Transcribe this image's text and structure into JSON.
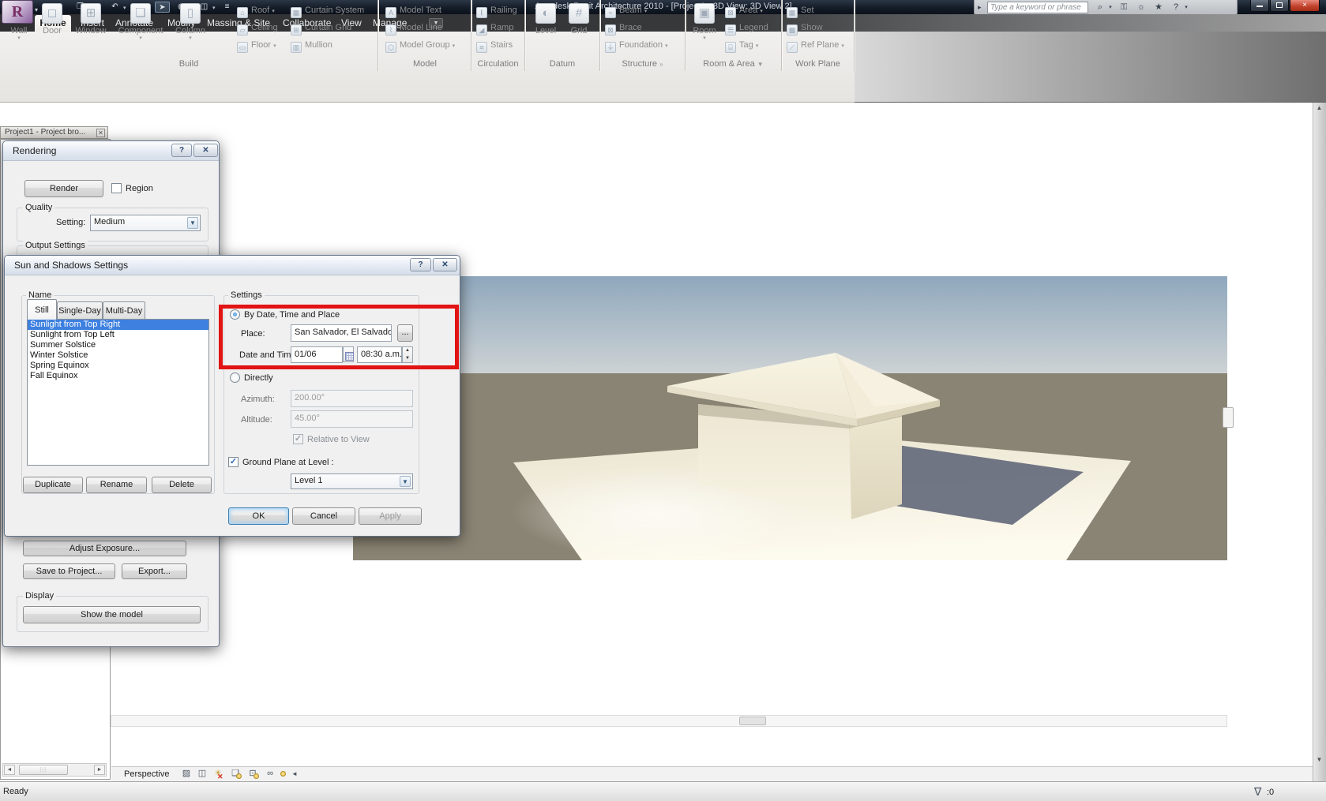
{
  "window": {
    "title": "Autodesk Revit Architecture 2010 - [Project1 - 3D View: 3D View 2]"
  },
  "infocenter": {
    "search_placeholder": "Type a keyword or phrase"
  },
  "tabs": {
    "items": [
      "Home",
      "Insert",
      "Annotate",
      "Modify",
      "Massing & Site",
      "Collaborate",
      "View",
      "Manage"
    ],
    "active": "Home"
  },
  "ribbon": {
    "build": {
      "label": "Build",
      "wall": "Wall",
      "door": "Door",
      "window": "Window",
      "component": "Component",
      "column": "Column",
      "roof": "Roof",
      "ceiling": "Ceiling",
      "floor": "Floor",
      "curtain_system": "Curtain System",
      "curtain_grid": "Curtain Grid",
      "mullion": "Mullion"
    },
    "model": {
      "label": "Model",
      "model_text": "Model Text",
      "model_line": "Model Line",
      "model_group": "Model Group"
    },
    "circulation": {
      "label": "Circulation",
      "railing": "Railing",
      "ramp": "Ramp",
      "stairs": "Stairs"
    },
    "datum": {
      "label": "Datum",
      "level": "Level",
      "grid": "Grid"
    },
    "structure": {
      "label": "Structure",
      "beam": "Beam",
      "brace": "Brace",
      "foundation": "Foundation"
    },
    "room_area": {
      "label": "Room & Area",
      "room": "Room",
      "area": "Area",
      "legend": "Legend",
      "tag": "Tag"
    },
    "work_plane": {
      "label": "Work Plane",
      "set": "Set",
      "show": "Show",
      "ref_plane": "Ref Plane"
    }
  },
  "browser": {
    "tab_label": "Project1 - Project bro..."
  },
  "rendering": {
    "title": "Rendering",
    "render": "Render",
    "region": "Region",
    "quality": "Quality",
    "setting": "Setting:",
    "setting_value": "Medium",
    "output_settings": "Output Settings",
    "adjust_exposure": "Adjust Exposure...",
    "save_to_project": "Save to Project...",
    "export": "Export...",
    "display": "Display",
    "show_the_model": "Show the model"
  },
  "sun": {
    "title": "Sun and Shadows Settings",
    "name": "Name",
    "tab_still": "Still",
    "tab_single": "Single-Day",
    "tab_multi": "Multi-Day",
    "presets": [
      "Sunlight from Top Right",
      "Sunlight from Top Left",
      "Summer Solstice",
      "Winter Solstice",
      "Spring Equinox",
      "Fall Equinox"
    ],
    "selected_preset": "Sunlight from Top Right",
    "duplicate": "Duplicate",
    "rename": "Rename",
    "delete": "Delete",
    "settings": "Settings",
    "by_date": "By Date, Time and Place",
    "place": "Place:",
    "place_value": "San Salvador, El Salvador",
    "browse": "...",
    "date_time": "Date and Time:",
    "date_value": "01/06",
    "time_value": "08:30 a.m.",
    "directly": "Directly",
    "azimuth": "Azimuth:",
    "azimuth_value": "200.00°",
    "altitude": "Altitude:",
    "altitude_value": "45.00°",
    "relative": "Relative to View",
    "ground_plane": "Ground Plane at Level :",
    "level": "Level 1",
    "ok": "OK",
    "cancel": "Cancel",
    "apply": "Apply"
  },
  "viewbar": {
    "view": "Perspective"
  },
  "status": {
    "ready": "Ready",
    "filter": ":0"
  },
  "colors": {
    "selection": "#3d80df",
    "annotation": "#e21313",
    "sky_top": "#8fa8bd",
    "ground": "#8a8474",
    "house": "#f3eedc"
  }
}
